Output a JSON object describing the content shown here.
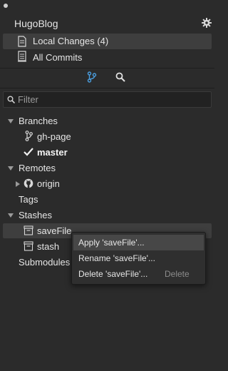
{
  "app": {
    "repo_name": "HugoBlog"
  },
  "nav": {
    "local_changes": "Local Changes (4)",
    "all_commits": "All Commits"
  },
  "filter": {
    "placeholder": "Filter"
  },
  "tree": {
    "branches": {
      "label": "Branches",
      "items": [
        "gh-page",
        "master"
      ],
      "current": "master"
    },
    "remotes": {
      "label": "Remotes",
      "items": [
        "origin"
      ]
    },
    "tags": {
      "label": "Tags"
    },
    "stashes": {
      "label": "Stashes",
      "items": [
        "saveFile",
        "stash"
      ]
    },
    "submodules": {
      "label": "Submodules"
    }
  },
  "context_menu": {
    "items": [
      {
        "label": "Apply 'saveFile'...",
        "shortcut": ""
      },
      {
        "label": "Rename 'saveFile'...",
        "shortcut": ""
      },
      {
        "label": "Delete 'saveFile'...",
        "shortcut": "Delete"
      }
    ]
  },
  "colors": {
    "accent": "#4a9fe0",
    "background": "#2b2b2b",
    "highlight": "#3e3e3e"
  }
}
